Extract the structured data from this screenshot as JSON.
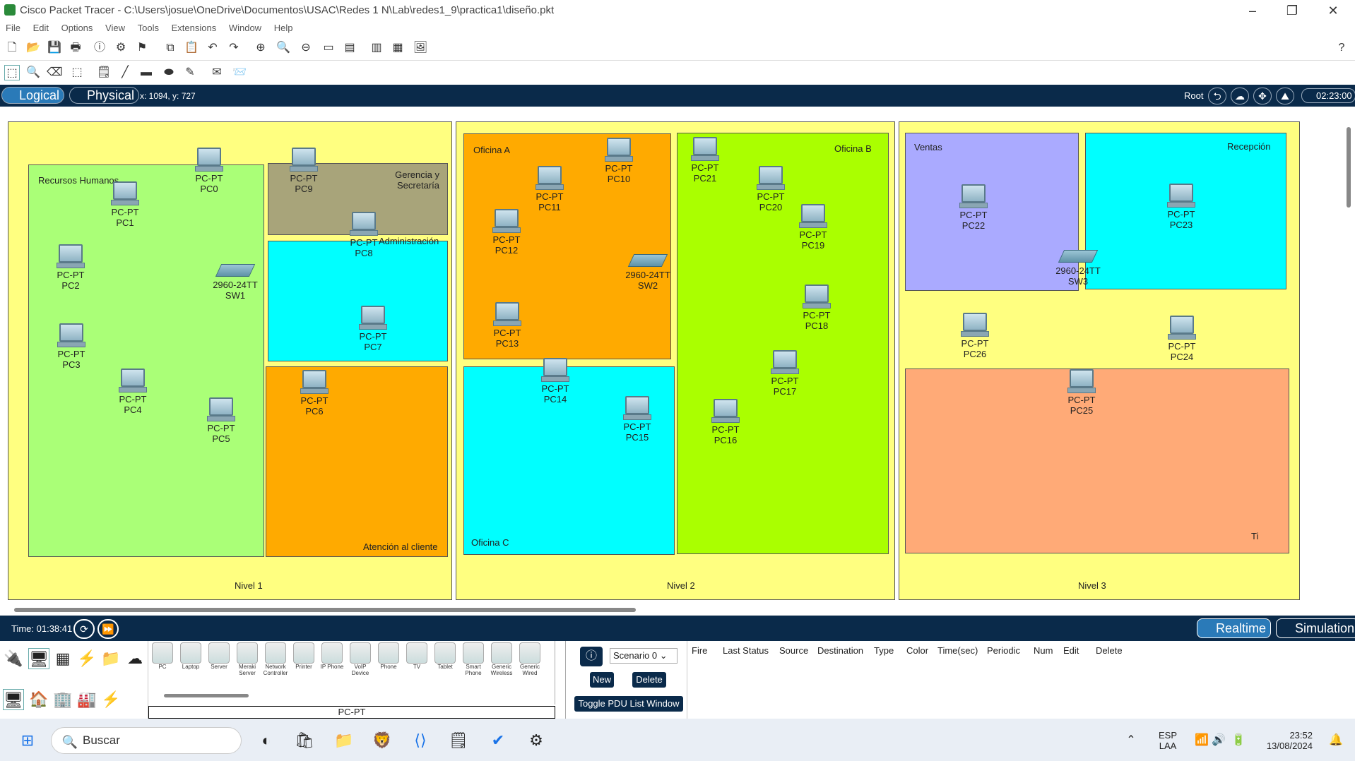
{
  "window": {
    "title": "Cisco Packet Tracer - C:\\Users\\josue\\OneDrive\\Documentos\\USAC\\Redes 1 N\\Lab\\redes1_9\\practica1\\diseño.pkt"
  },
  "menu": [
    "File",
    "Edit",
    "Options",
    "View",
    "Tools",
    "Extensions",
    "Window",
    "Help"
  ],
  "modebar": {
    "logical": "Logical",
    "physical": "Physical",
    "coords": "x: 1094, y: 727",
    "root": "Root",
    "clock": "02:23:00"
  },
  "levels": {
    "nivel1": "Nivel 1",
    "nivel2": "Nivel 2",
    "nivel3": "Nivel 3"
  },
  "zones": {
    "rrhh": "Recursos Humanos",
    "gerencia": "Gerencia y\nSecretaría",
    "admin": "Administración",
    "atencion": "Atención al cliente",
    "oficinaA": "Oficina A",
    "oficinaB": "Oficina B",
    "oficinaC": "Oficina C",
    "ventas": "Ventas",
    "recepcion": "Recepción",
    "ti": "Ti"
  },
  "device_type": "PC-PT",
  "switch_type": "2960-24TT",
  "pcs": [
    "PC0",
    "PC1",
    "PC2",
    "PC3",
    "PC4",
    "PC5",
    "PC6",
    "PC7",
    "PC8",
    "PC9",
    "PC10",
    "PC11",
    "PC12",
    "PC13",
    "PC14",
    "PC15",
    "PC16",
    "PC17",
    "PC18",
    "PC19",
    "PC20",
    "PC21",
    "PC22",
    "PC23",
    "PC24",
    "PC25",
    "PC26"
  ],
  "switches": [
    "SW1",
    "SW2",
    "SW3"
  ],
  "timebar": {
    "time": "Time: 01:38:41",
    "realtime": "Realtime",
    "simulation": "Simulation"
  },
  "devices": [
    "PC",
    "Laptop",
    "Server",
    "Meraki Server",
    "Network Controller",
    "Printer",
    "IP Phone",
    "VoIP Device",
    "Phone",
    "TV",
    "Tablet",
    "Smart Phone",
    "Generic Wireless",
    "Generic Wired"
  ],
  "selected_device": "PC-PT",
  "scenario": {
    "select": "Scenario 0",
    "new": "New",
    "delete": "Delete",
    "toggle": "Toggle PDU List Window"
  },
  "pdu_headers": [
    "Fire",
    "Last Status",
    "Source",
    "Destination",
    "Type",
    "Color",
    "Time(sec)",
    "Periodic",
    "Num",
    "Edit",
    "Delete"
  ],
  "taskbar": {
    "search": "Buscar",
    "lang1": "ESP",
    "lang2": "LAA",
    "time": "23:52",
    "date": "13/08/2024"
  },
  "colors": {
    "level": "#ffff80",
    "green": "#aaff77",
    "olive": "#a8a47a",
    "cyan": "#00ffff",
    "orange": "#ffaa00",
    "lime": "#aaff00",
    "lavender": "#aaaaff",
    "salmon": "#ffaa77"
  }
}
